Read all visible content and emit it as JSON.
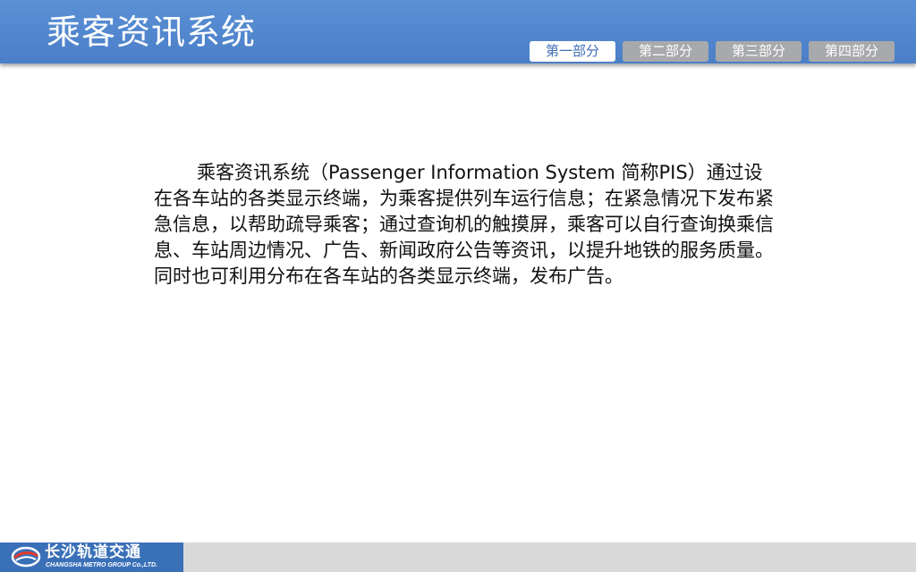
{
  "header": {
    "title": "乘客资讯系统",
    "tabs": [
      {
        "label": "第一部分",
        "active": true
      },
      {
        "label": "第二部分",
        "active": false
      },
      {
        "label": "第三部分",
        "active": false
      },
      {
        "label": "第四部分",
        "active": false
      }
    ]
  },
  "content": {
    "paragraph": "乘客资讯系统（Passenger Information System 简称PIS）通过设在各车站的各类显示终端，为乘客提供列车运行信息；在紧急情况下发布紧急信息，以帮助疏导乘客；通过查询机的触摸屏，乘客可以自行查询换乘信息、车站周边情况、广告、新闻政府公告等资讯，以提升地铁的服务质量。同时也可利用分布在各车站的各类显示终端，发布广告。"
  },
  "footer": {
    "logo_cn": "长沙轨道交通",
    "logo_en": "CHANGSHA METRO GROUP Co.,LTD."
  },
  "colors": {
    "header_blue": "#4a7fc8",
    "tab_inactive": "#a7a9ac",
    "tab_active_text": "#3f6fb5",
    "footer_logo_bg": "#3a70b8",
    "footer_bar": "#d9d9d9"
  }
}
